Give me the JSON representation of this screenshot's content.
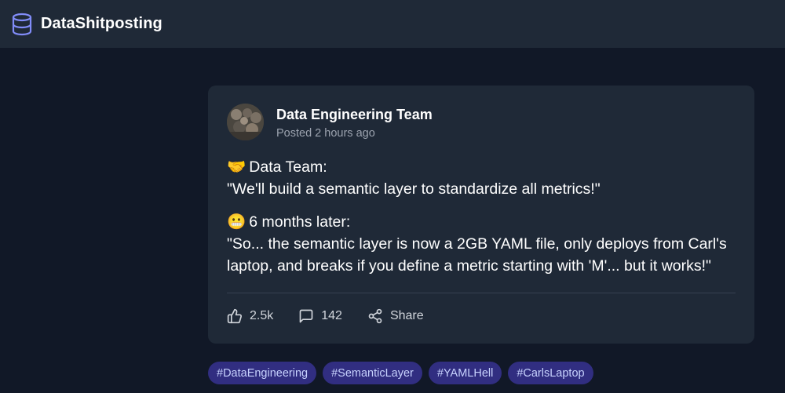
{
  "header": {
    "brand": "DataShitposting",
    "logo_icon": "database-icon"
  },
  "post": {
    "author": "Data Engineering Team",
    "time": "Posted 2 hours ago",
    "paragraphs": [
      {
        "emoji": "🤝",
        "heading": "Data Team:",
        "quote": "\"We'll build a semantic layer to standardize all metrics!\""
      },
      {
        "emoji": "😬",
        "heading": "6 months later:",
        "quote_line1": "\"So... the semantic layer is now a 2GB YAML file, only deploys from Carl's",
        "quote_line2": "laptop, and breaks if you define a metric starting with 'M'... but it works!\""
      }
    ],
    "actions": {
      "like": {
        "icon": "thumbs-up-icon",
        "label": "2.5k"
      },
      "comment": {
        "icon": "comment-icon",
        "label": "142"
      },
      "share": {
        "icon": "share-icon",
        "label": "Share"
      }
    }
  },
  "tags": [
    "#DataEngineering",
    "#SemanticLayer",
    "#YAMLHell",
    "#CarlsLaptop"
  ],
  "colors": {
    "background": "#111827",
    "card": "#1f2937",
    "accent": "#818cf8",
    "tag_bg": "#312e81",
    "tag_text": "#c7d2fe",
    "muted": "#9ca3af"
  }
}
